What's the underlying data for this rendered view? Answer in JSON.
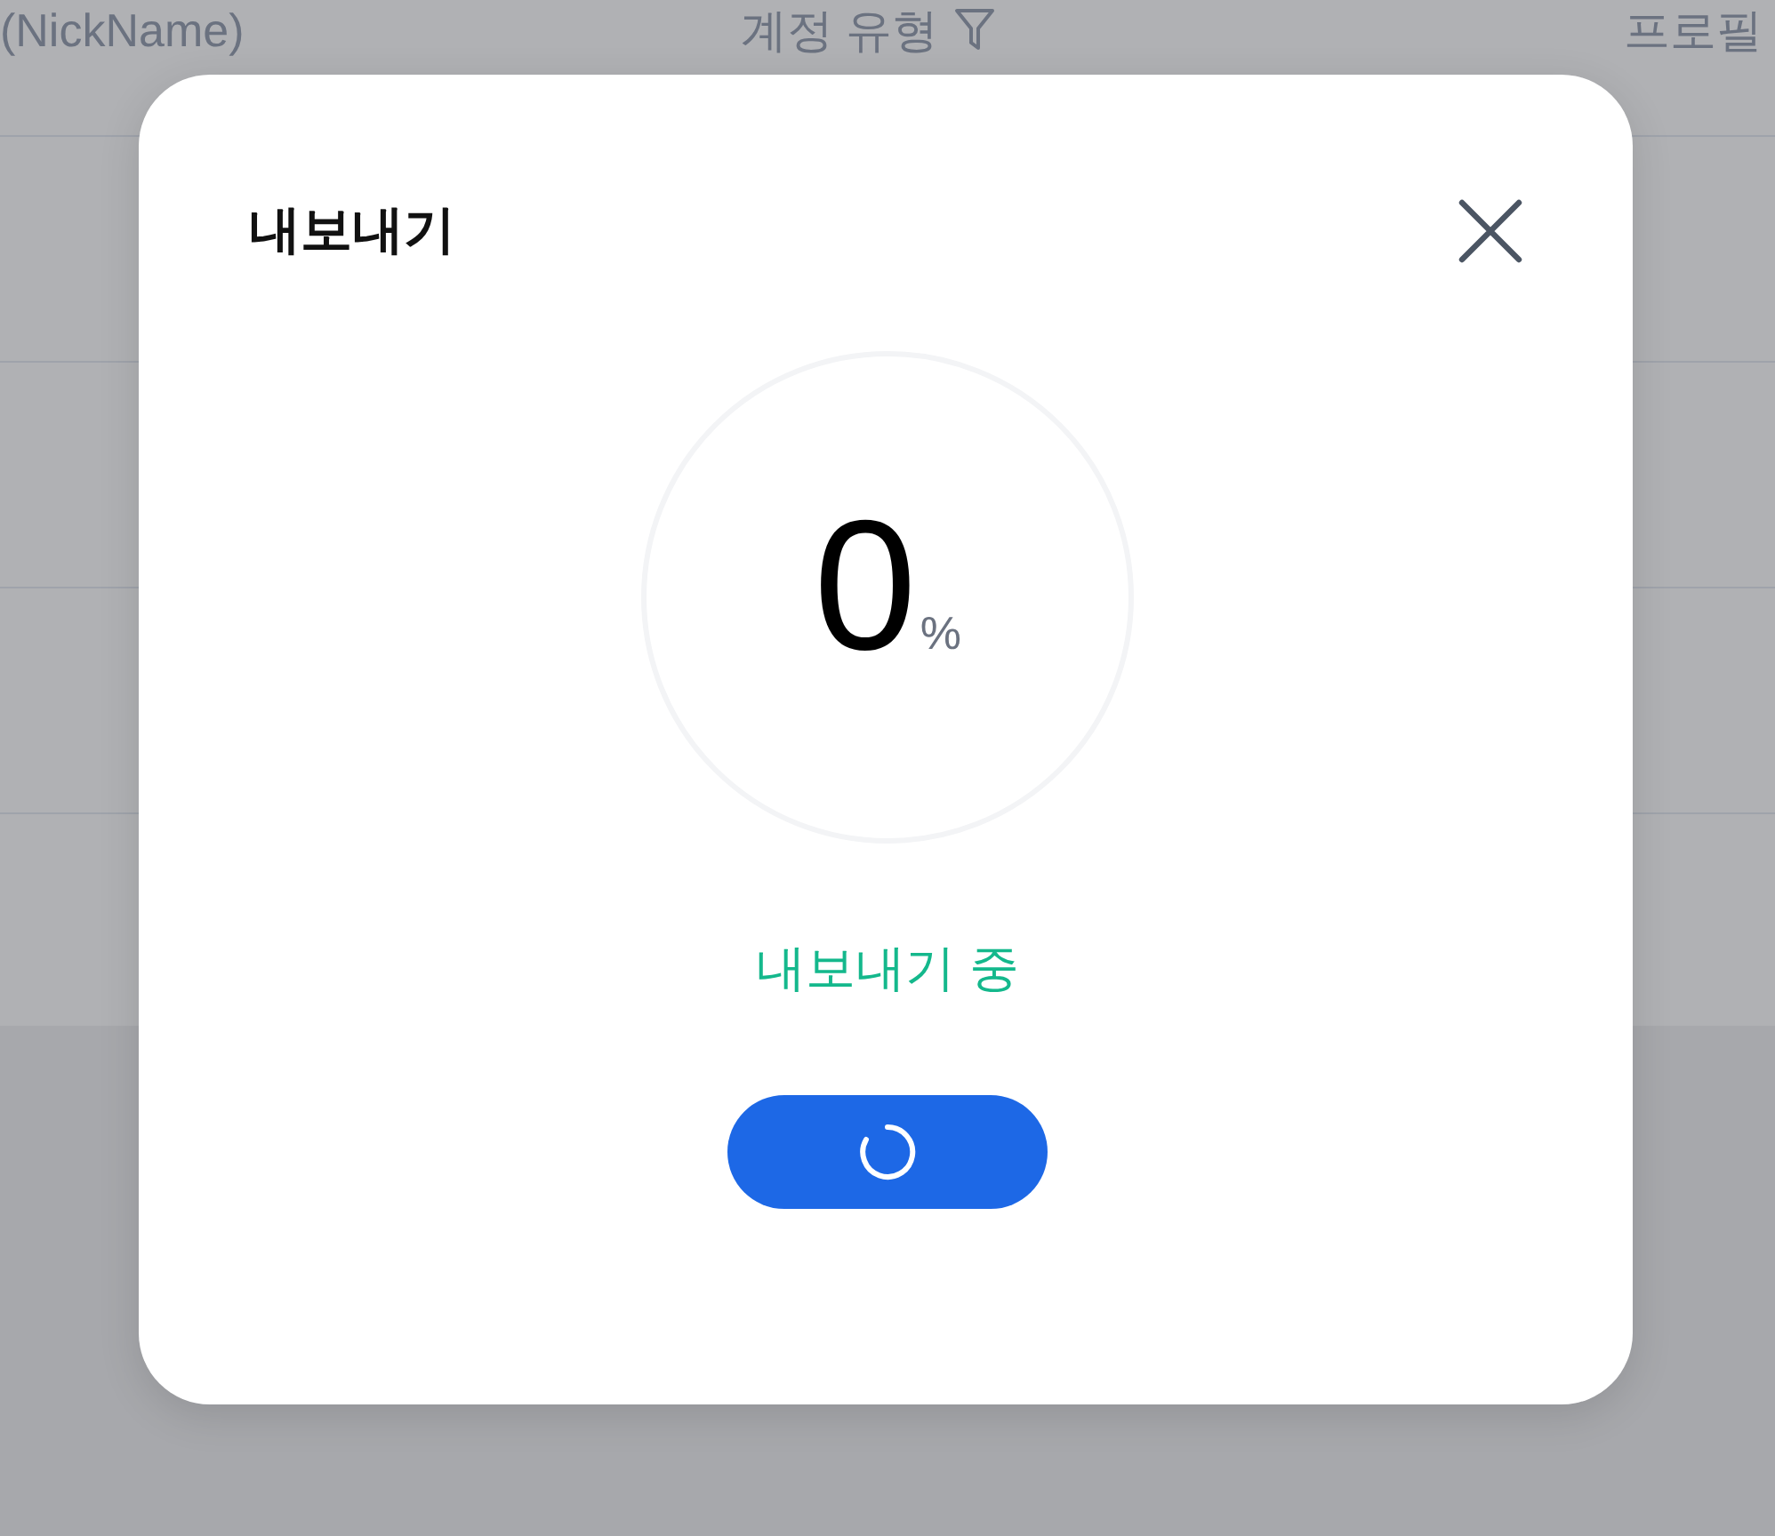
{
  "table": {
    "columns": [
      {
        "label": "(NickName)",
        "filter": false
      },
      {
        "label": "계정 유형",
        "filter": true
      },
      {
        "label": "프로필",
        "filter": false
      }
    ]
  },
  "dialog": {
    "title": "내보내기",
    "progress": {
      "level": 0,
      "value": "0",
      "unit": "%"
    },
    "status": "내보내기 중",
    "button": {
      "loading": true
    }
  }
}
